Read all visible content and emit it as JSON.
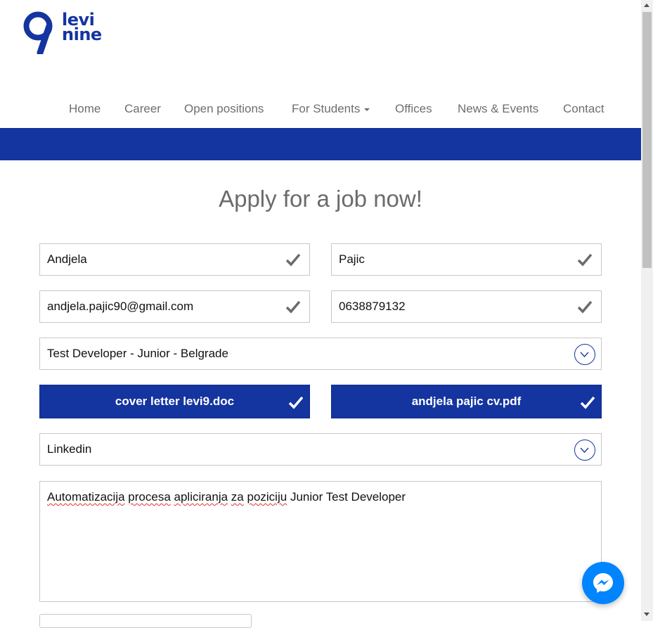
{
  "brand": {
    "logo_line1": "levi",
    "logo_line2": "nine",
    "primary_color": "#1434a0"
  },
  "nav": {
    "items": [
      {
        "label": "Home"
      },
      {
        "label": "Career"
      },
      {
        "label": "Open positions"
      },
      {
        "label": "For Students",
        "has_dropdown": true
      },
      {
        "label": "Offices"
      },
      {
        "label": "News & Events"
      },
      {
        "label": "Contact"
      }
    ]
  },
  "form": {
    "title": "Apply for a job now!",
    "first_name": "Andjela",
    "last_name": "Pajic",
    "email": "andjela.pajic90@gmail.com",
    "phone": "0638879132",
    "position": "Test Developer - Junior - Belgrade",
    "cover_letter_file": "cover letter levi9.doc",
    "cv_file": "andjela pajic cv.pdf",
    "source": "Linkedin",
    "message_words": [
      "Automatizacija",
      "procesa",
      "apliciranja",
      "za",
      "poziciju",
      "Junior Test Developer"
    ]
  },
  "icons": {
    "valid": "checkmark-icon",
    "select": "chevron-down-icon",
    "chat": "messenger-icon"
  }
}
